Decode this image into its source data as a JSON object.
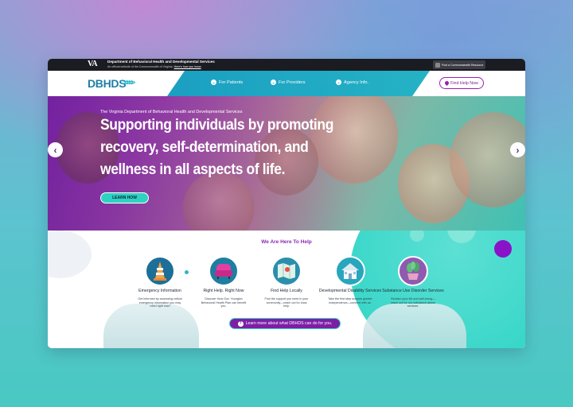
{
  "gov_bar": {
    "logo": "VA",
    "title": "Department of Behavioral Health and Developmental Services",
    "subtitle": "An official website of the Commonwealth of Virginia",
    "subtitle_link": "Here's how you know",
    "commonwealth_button": "Find a Commonwealth Resource"
  },
  "nav": {
    "logo": "DBHDS",
    "logo_arrows": ">>>>>",
    "items": [
      {
        "label": "For Patients"
      },
      {
        "label": "For Providers"
      },
      {
        "label": "Agency Info."
      }
    ],
    "find_help": "Find Help Now"
  },
  "hero": {
    "pretitle": "The Virginia Department of Behavioral Health and Developmental Services",
    "headline_lines": [
      "Supporting individuals by promoting",
      "recovery, self-determination, and",
      "wellness in all aspects of life."
    ],
    "cta": "LEARN HOW",
    "prev_arrow": "‹",
    "next_arrow": "›"
  },
  "services": {
    "title": "We Are Here To Help",
    "items": [
      {
        "name": "Emergency Information",
        "desc": "Get informed by accessing critical emergency information you may need right now!",
        "icon": "traffic-cone-icon",
        "color": "#1d6f98"
      },
      {
        "name": "Right Help. Right Now",
        "desc": "Discover How Gov. Youngkin Behavioral Health Plan can benefit you.",
        "icon": "armchair-icon",
        "color": "#1d7ea3"
      },
      {
        "name": "Find Help Locally",
        "desc": "Find the support you need in your community—reach out for local help.",
        "icon": "map-icon",
        "color": "#2a8fad"
      },
      {
        "name": "Developmental Disability Services",
        "desc": "Take the first step towards greater independence—connect with us.",
        "icon": "house-icon",
        "color": "#27a6bd"
      },
      {
        "name": "Substance Use Disorder Services",
        "desc": "Reclaim your life and well-being—reach out for our substance abuse services.",
        "icon": "plant-icon",
        "color": "#8e5bb0"
      }
    ],
    "more_button": "Learn more about what DBHDS can do for you."
  }
}
